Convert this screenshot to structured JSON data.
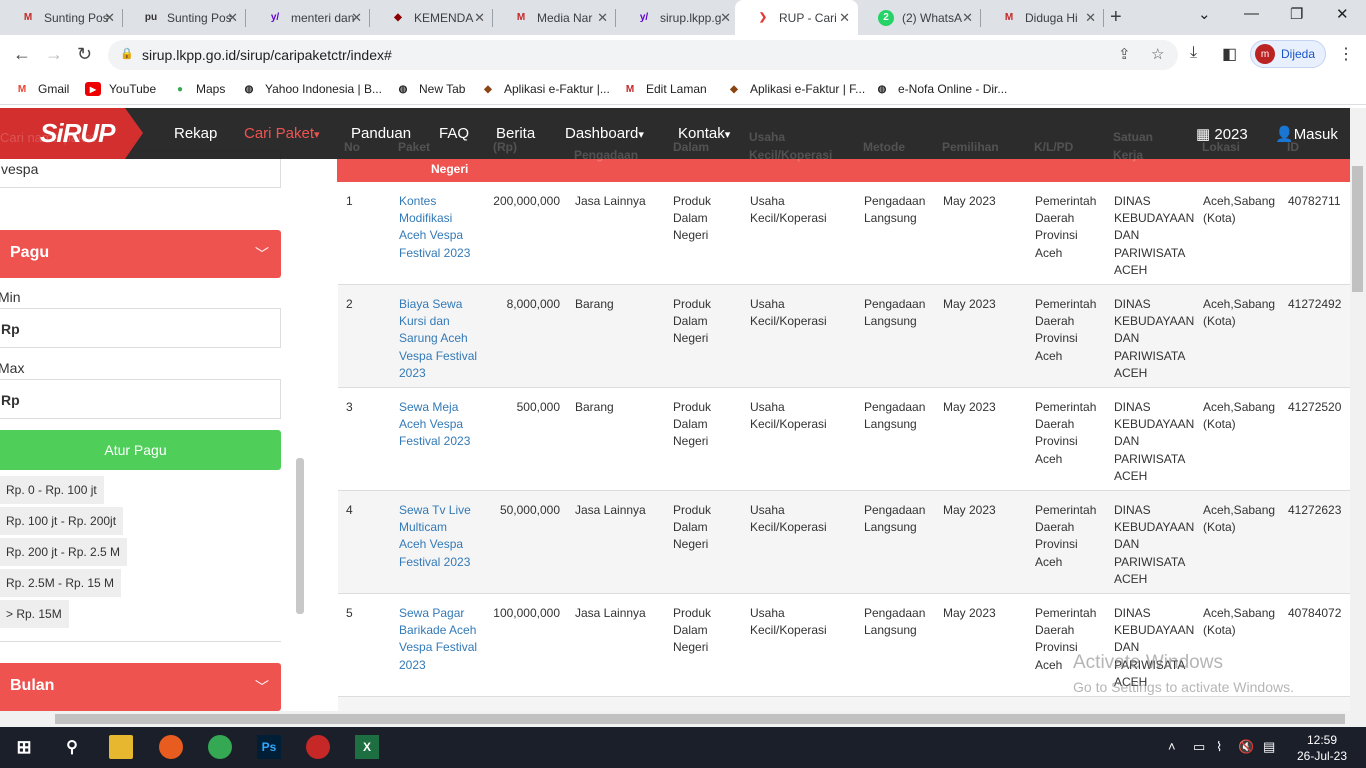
{
  "browser": {
    "tabs": [
      {
        "title": "Sunting Pos",
        "icon": "gs-icon",
        "color": "#c62828"
      },
      {
        "title": "Sunting Pos",
        "icon": "pu-icon",
        "color": "#333"
      },
      {
        "title": "menteri dan",
        "icon": "yahoo-icon",
        "color": "#6001d2"
      },
      {
        "title": "KEMENDA",
        "icon": "emblem-icon",
        "color": "#8b0000"
      },
      {
        "title": "Media Nar",
        "icon": "gs-icon",
        "color": "#c62828"
      },
      {
        "title": "sirup.lkpp.g",
        "icon": "yahoo-icon",
        "color": "#6001d2"
      },
      {
        "title": "RUP - Cari",
        "icon": "sirup-icon",
        "color": "#e53935"
      },
      {
        "title": "(2) WhatsA",
        "icon": "whatsapp-icon",
        "color": "#25d366"
      },
      {
        "title": "Diduga Hi",
        "icon": "gs-icon",
        "color": "#c62828"
      }
    ],
    "url": "sirup.lkpp.go.id/sirup/caripaketctr/index#",
    "profile": "Dijeda",
    "bookmarks": [
      {
        "label": "Gmail",
        "icon": "gmail-icon"
      },
      {
        "label": "YouTube",
        "icon": "youtube-icon"
      },
      {
        "label": "Maps",
        "icon": "maps-icon"
      },
      {
        "label": "Yahoo Indonesia | B...",
        "icon": "globe-icon"
      },
      {
        "label": "New Tab",
        "icon": "globe-icon"
      },
      {
        "label": "Aplikasi e-Faktur |...",
        "icon": "emblem-icon"
      },
      {
        "label": "Edit Laman",
        "icon": "gs-icon"
      },
      {
        "label": "Aplikasi e-Faktur | F...",
        "icon": "emblem-icon"
      },
      {
        "label": "e-Nofa Online - Dir...",
        "icon": "globe-icon"
      }
    ]
  },
  "navbar": {
    "logo": "SiRUP",
    "items": [
      "Rekap",
      "Cari Paket",
      "Panduan",
      "FAQ",
      "Berita",
      "Dashboard",
      "Kontak"
    ],
    "year": "2023",
    "login": "Masuk"
  },
  "sidebar": {
    "search_placeholder": "Cari nama paket",
    "search_value": "vespa",
    "pagu_title": "Pagu",
    "min_label": "Min",
    "min_value": "Rp",
    "max_label": "Max",
    "max_value": "Rp",
    "atur_button": "Atur Pagu",
    "ranges": [
      "Rp. 0 - Rp. 100 jt",
      "Rp. 100 jt - Rp. 200jt",
      "Rp. 200 jt - Rp. 2.5 M",
      "Rp. 2.5M - Rp. 15 M",
      "> Rp. 15M"
    ],
    "bulan_title": "Bulan"
  },
  "table": {
    "headers": [
      "No",
      "Paket",
      "Pagu (Rp)",
      "Jenis Pengadaan",
      "Produk Dalam Negeri",
      "Usaha Kecil/Koperasi",
      "Metode",
      "Pemilihan",
      "K/L/PD",
      "Satuan Kerja",
      "Lokasi",
      "ID"
    ],
    "rows": [
      {
        "no": "1",
        "paket": [
          "Kontes",
          "Modifikasi",
          "Aceh Vespa",
          "Festival 2023"
        ],
        "pagu": "200,000,000",
        "jenis": "Jasa Lainnya",
        "id": "40782711"
      },
      {
        "no": "2",
        "paket": [
          "Biaya Sewa",
          "Kursi dan",
          "Sarung Aceh",
          "Vespa Festival",
          "2023"
        ],
        "pagu": "8,000,000",
        "jenis": "Barang",
        "id": "41272492"
      },
      {
        "no": "3",
        "paket": [
          "Sewa Meja",
          "Aceh Vespa",
          "Festival 2023"
        ],
        "pagu": "500,000",
        "jenis": "Barang",
        "id": "41272520"
      },
      {
        "no": "4",
        "paket": [
          "Sewa Tv Live",
          "Multicam",
          "Aceh Vespa",
          "Festival 2023"
        ],
        "pagu": "50,000,000",
        "jenis": "Jasa Lainnya",
        "id": "41272623"
      },
      {
        "no": "5",
        "paket": [
          "Sewa Pagar",
          "Barikade Aceh",
          "Vespa Festival",
          "2023"
        ],
        "pagu": "100,000,000",
        "jenis": "Jasa Lainnya",
        "id": "40784072"
      }
    ],
    "common": {
      "pdn": [
        "Produk",
        "Dalam",
        "Negeri"
      ],
      "ukm": [
        "Usaha",
        "Kecil/Koperasi"
      ],
      "metode": [
        "Pengadaan",
        "Langsung"
      ],
      "pemilihan": "May 2023",
      "klpd": [
        "Pemerintah",
        "Daerah",
        "Provinsi",
        "Aceh"
      ],
      "satker": [
        "DINAS",
        "KEBUDAYAAN",
        "DAN",
        "PARIWISATA",
        "ACEH"
      ],
      "lokasi": [
        "Aceh,Sabang",
        "(Kota)"
      ]
    }
  },
  "watermark": {
    "line1": "Activate Windows",
    "line2": "Go to Settings to activate Windows."
  },
  "taskbar": {
    "time": "12:59",
    "date": "26-Jul-23"
  }
}
